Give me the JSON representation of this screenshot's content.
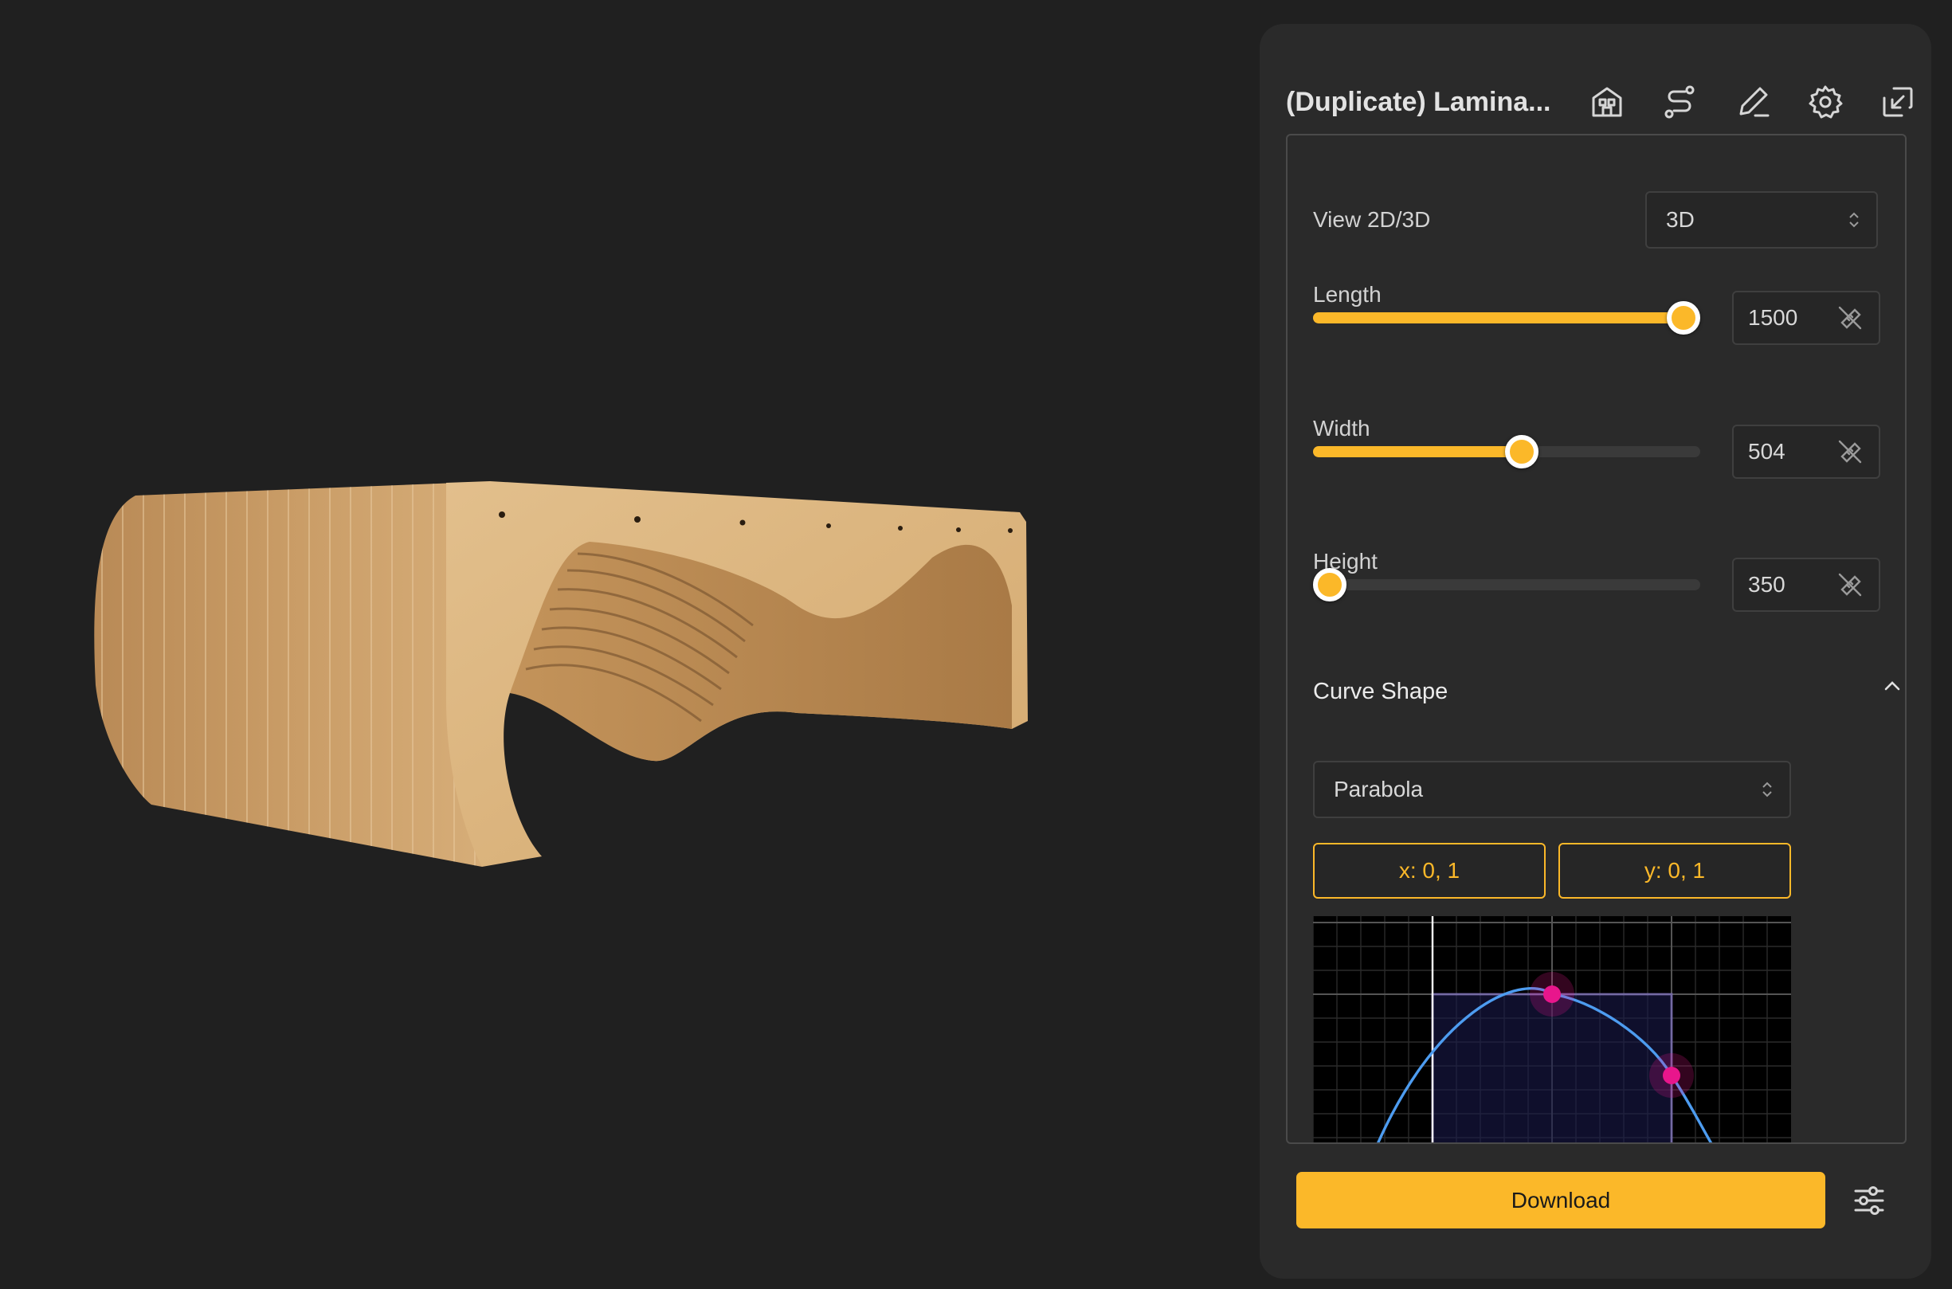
{
  "app": {
    "title": "(Duplicate) Lamina..."
  },
  "header": {
    "icons": [
      "building-icon",
      "route-icon",
      "edit-pencil-icon",
      "gear-icon",
      "collapse-window-icon"
    ]
  },
  "view": {
    "label": "View 2D/3D",
    "value": "3D"
  },
  "params": [
    {
      "label": "Length",
      "value": "1500",
      "fraction": 0.997
    },
    {
      "label": "Width",
      "value": "504",
      "fraction": 0.54
    },
    {
      "label": "Height",
      "value": "350",
      "fraction": 0.0
    }
  ],
  "curve": {
    "section_title": "Curve Shape",
    "shape": "Parabola",
    "x_range_label": "x: 0, 1",
    "y_range_label": "y: 0, 1"
  },
  "download_label": "Download",
  "colors": {
    "accent": "#fbb829",
    "panel": "#2a2a2a",
    "background": "#202020",
    "curve_line": "#4d9cf0",
    "control_point": "#e8168c"
  }
}
